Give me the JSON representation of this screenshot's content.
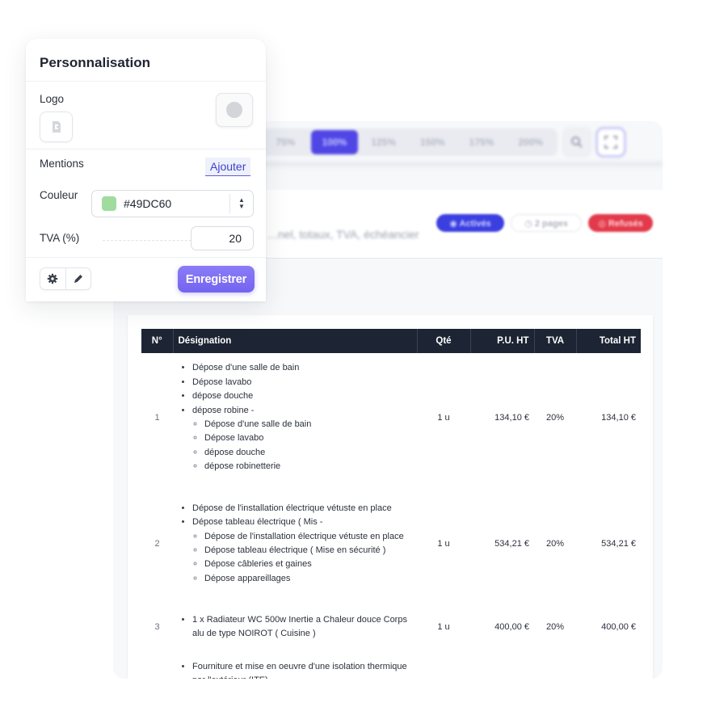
{
  "panel": {
    "title": "Personnalisation",
    "logo_label": "Logo",
    "mentions_label": "Mentions",
    "add_label": "Ajouter",
    "color_label": "Couleur",
    "color_value": "#49DC60",
    "tva_label": "TVA (%)",
    "tva_value": "20",
    "save_label": "Enregistrer",
    "accent_color": "#7364EF"
  },
  "toolbar": {
    "zoom_levels": [
      "75%",
      "100%",
      "125%",
      "150%",
      "175%",
      "200%"
    ],
    "active_zoom": "100%",
    "icons": [
      "zoom-search-icon",
      "fullscreen-icon"
    ]
  },
  "document_header": {
    "subtitle": "…nel, totaux, TVA, échéancier",
    "status_active": "◉ Activés",
    "pages": "◷ 2 pages",
    "status_refused": "◎ Refusés"
  },
  "table": {
    "headers": {
      "no": "N°",
      "designation": "Désignation",
      "qty": "Qté",
      "unit_price": "P.U. HT",
      "tva": "TVA",
      "total": "Total HT"
    },
    "rows": [
      {
        "no": "1",
        "items": [
          {
            "text": "Dépose d'une salle de bain"
          },
          {
            "text": "Dépose lavabo"
          },
          {
            "text": "dépose douche"
          },
          {
            "text": "dépose robine -",
            "sub": [
              "Dépose d'une salle de bain",
              "Dépose lavabo",
              "dépose douche",
              "dépose robinetterie"
            ]
          }
        ],
        "qty": "1 u",
        "unit_price": "134,10 €",
        "tva": "20%",
        "total": "134,10 €"
      },
      {
        "no": "2",
        "items": [
          {
            "text": "Dépose de l'installation électrique vétuste en place"
          },
          {
            "text": "Dépose tableau électrique ( Mis -",
            "sub": [
              "Dépose de l'installation électrique vétuste en place",
              "Dépose tableau électrique ( Mise en sécurité )",
              "Dépose câbleries et gaines",
              "Dépose appareillages"
            ]
          }
        ],
        "qty": "1 u",
        "unit_price": "534,21 €",
        "tva": "20%",
        "total": "534,21 €"
      },
      {
        "no": "3",
        "items": [
          {
            "text": "1 x Radiateur WC 500w Inertie a Chaleur douce Corps alu de type NOIROT ( Cuisine )"
          }
        ],
        "qty": "1 u",
        "unit_price": "400,00 €",
        "tva": "20%",
        "total": "400,00 €"
      },
      {
        "no": "",
        "items": [
          {
            "text": "Fourniture et mise en oeuvre d'une isolation thermique par l'extérieur (ITE)"
          }
        ],
        "qty": "",
        "unit_price": "",
        "tva": "",
        "total": ""
      }
    ]
  }
}
